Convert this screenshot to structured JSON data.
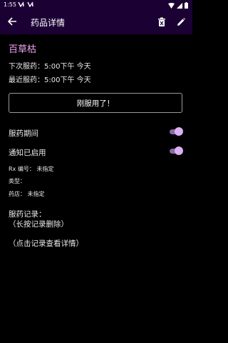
{
  "status": {
    "time": "1:55"
  },
  "appbar": {
    "title": "药品详情"
  },
  "med": {
    "name": "百草枯",
    "next_dose": "下次服药：5:00下午 今天",
    "last_dose": "最近服药：5:00下午 今天",
    "taken_button": "刚服用了！"
  },
  "toggles": {
    "period_label": "服药期间",
    "period_on": true,
    "notify_label": "通知已启用",
    "notify_on": true
  },
  "details": {
    "rx": "Rx 编号：   未指定",
    "type": "类型：",
    "store": "药店：   未指定"
  },
  "records": {
    "title": "服药记录：",
    "hint_delete": "（长按记录删除）",
    "hint_view": "（点击记录查看详情）"
  },
  "colors": {
    "appbar": "#1b0034",
    "accent_name": "#f2a3f2",
    "switch_thumb": "#dcb0f2",
    "switch_track": "#8a6aa0"
  }
}
